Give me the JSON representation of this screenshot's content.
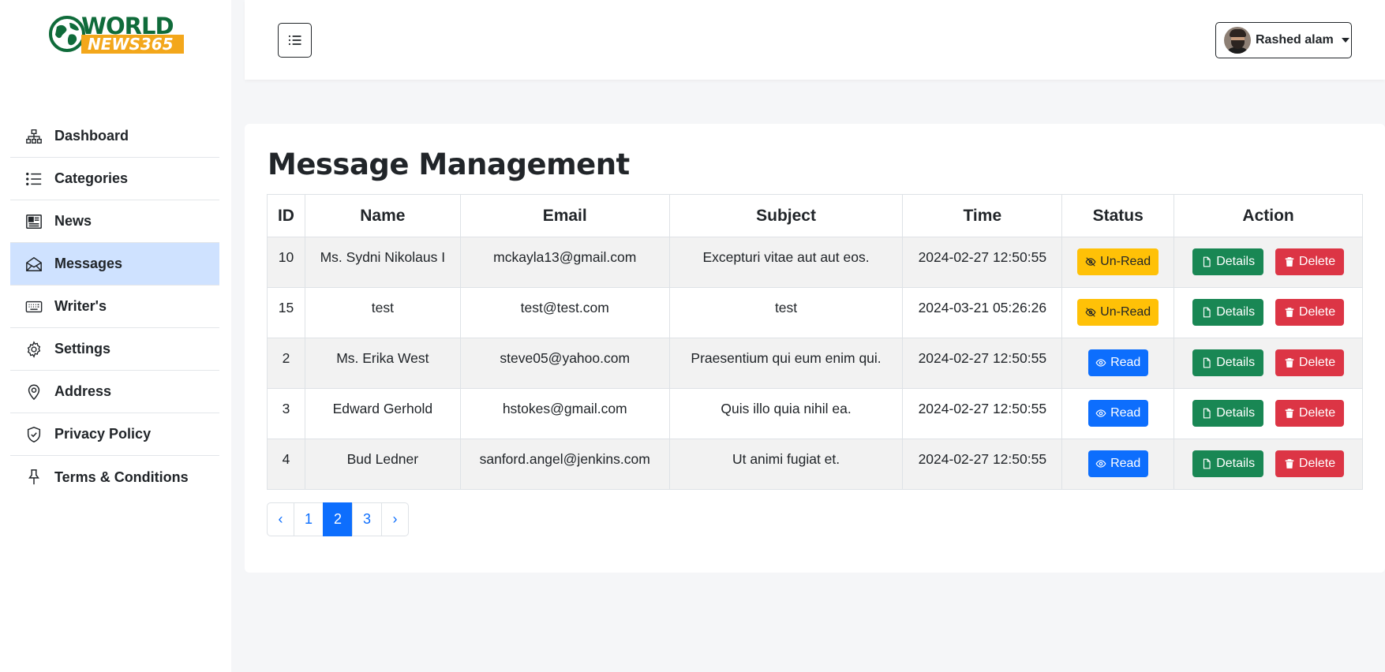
{
  "brand": {
    "line1": "WORLD",
    "line2": "NEWS365"
  },
  "sidebar": {
    "items": [
      {
        "label": "Dashboard",
        "icon": "sitemap-icon"
      },
      {
        "label": "Categories",
        "icon": "list-icon"
      },
      {
        "label": "News",
        "icon": "newspaper-icon"
      },
      {
        "label": "Messages",
        "icon": "envelope-open-icon",
        "active": true
      },
      {
        "label": "Writer's",
        "icon": "keyboard-icon"
      },
      {
        "label": "Settings",
        "icon": "gear-icon"
      },
      {
        "label": "Address",
        "icon": "map-pin-icon"
      },
      {
        "label": "Privacy Policy",
        "icon": "shield-check-icon"
      },
      {
        "label": "Terms & Conditions",
        "icon": "pushpin-icon"
      }
    ]
  },
  "header": {
    "user_name": "Rashed alam"
  },
  "main": {
    "title": "Message Management",
    "columns": [
      "ID",
      "Name",
      "Email",
      "Subject",
      "Time",
      "Status",
      "Action"
    ],
    "rows": [
      {
        "id": "10",
        "name": "Ms. Sydni Nikolaus I",
        "email": "mckayla13@gmail.com",
        "subject": "Excepturi vitae aut aut eos.",
        "time": "2024-02-27 12:50:55",
        "status": "Un-Read"
      },
      {
        "id": "15",
        "name": "test",
        "email": "test@test.com",
        "subject": "test",
        "time": "2024-03-21 05:26:26",
        "status": "Un-Read"
      },
      {
        "id": "2",
        "name": "Ms. Erika West",
        "email": "steve05@yahoo.com",
        "subject": "Praesentium qui eum enim qui.",
        "time": "2024-02-27 12:50:55",
        "status": "Read"
      },
      {
        "id": "3",
        "name": "Edward Gerhold",
        "email": "hstokes@gmail.com",
        "subject": "Quis illo quia nihil ea.",
        "time": "2024-02-27 12:50:55",
        "status": "Read"
      },
      {
        "id": "4",
        "name": "Bud Ledner",
        "email": "sanford.angel@jenkins.com",
        "subject": "Ut animi fugiat et.",
        "time": "2024-02-27 12:50:55",
        "status": "Read"
      }
    ],
    "actions": {
      "details": "Details",
      "delete": "Delete"
    }
  },
  "pagination": {
    "prev": "‹",
    "pages": [
      "1",
      "2",
      "3"
    ],
    "current": "2",
    "next": "›"
  },
  "colors": {
    "accent": "#0d6efd",
    "success": "#198754",
    "danger": "#dc3545",
    "warning": "#ffc107",
    "active_nav": "#cfe2ff",
    "brand_green": "#0f6b3a",
    "brand_orange": "#f3a71b"
  }
}
